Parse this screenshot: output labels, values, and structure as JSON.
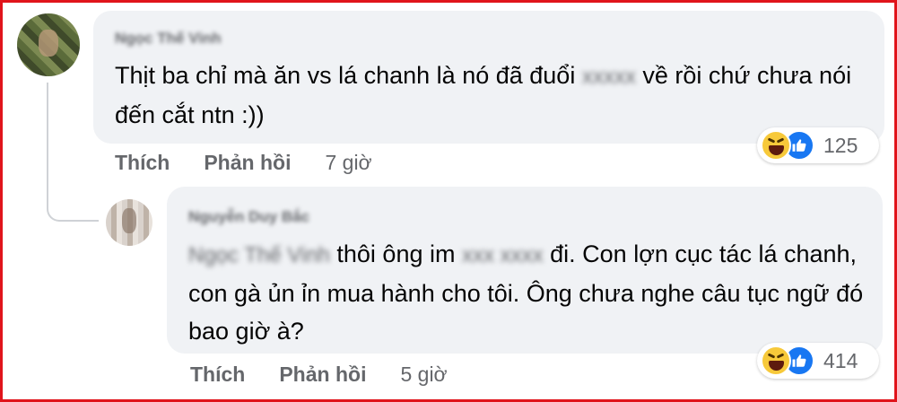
{
  "comments": [
    {
      "author": "Ngọc Thế Vinh",
      "text_before": "Thịt ba chỉ mà ăn vs lá chanh là nó đã đuổi ",
      "text_blurred": "xxxxx",
      "text_after": " về rồi chứ chưa nói đến cắt ntn :))",
      "actions": {
        "like": "Thích",
        "reply": "Phản hồi",
        "time": "7 giờ"
      },
      "reactions": {
        "icons": [
          "haha-icon",
          "like-icon"
        ],
        "count": "125"
      }
    },
    {
      "author": "Nguyễn Duy Bắc",
      "mention": "Ngọc Thế Vinh",
      "text_a": " thôi ông im ",
      "text_blurred": "xxx xxxx",
      "text_b": " đi. Con lợn cục tác lá chanh, con gà ủn ỉn mua hành cho tôi. Ông chưa nghe câu tục ngữ đó bao giờ à?",
      "actions": {
        "like": "Thích",
        "reply": "Phản hồi",
        "time": "5 giờ"
      },
      "reactions": {
        "icons": [
          "haha-icon",
          "like-icon"
        ],
        "count": "414"
      }
    }
  ],
  "colors": {
    "frame": "#e0141b",
    "bubble": "#f0f2f5",
    "secondary_text": "#65676b",
    "like_blue": "#1877f2",
    "haha_yellow": "#f7c93a"
  }
}
